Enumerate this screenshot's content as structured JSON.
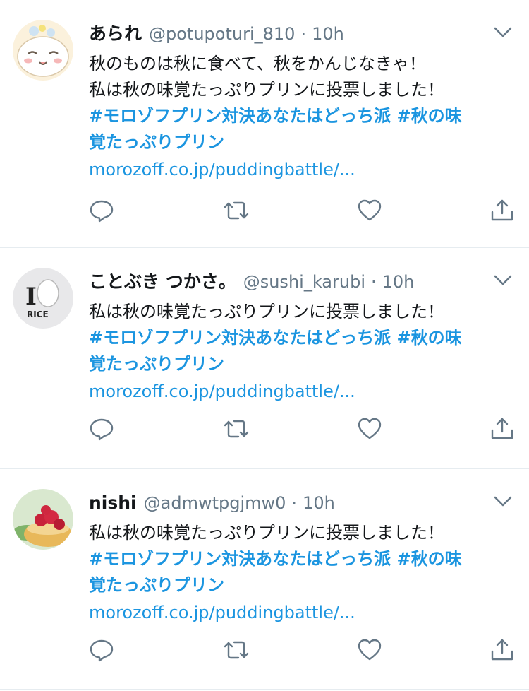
{
  "tweets": [
    {
      "name": "あられ",
      "handle": "@potupoturi_810",
      "separator": "·",
      "time": "10h",
      "text_lines": [
        "秋のものは秋に食べて、秋をかんじなきゃ！",
        "私は秋の味覚たっぷりプリンに投票しました！"
      ],
      "hashtag_line1": "#モロゾフプリン対決あなたはどっち派 #秋の味",
      "hashtag_line2": "覚たっぷりプリン",
      "link": "morozoff.co.jp/puddingbattle/..."
    },
    {
      "name": "ことぶき つかさ。",
      "handle": "@sushi_karubi",
      "separator": "·",
      "time": "10h",
      "text_lines": [
        "私は秋の味覚たっぷりプリンに投票しました！"
      ],
      "hashtag_line1": "#モロゾフプリン対決あなたはどっち派 #秋の味",
      "hashtag_line2": "覚たっぷりプリン",
      "link": "morozoff.co.jp/puddingbattle/...",
      "avatar_text": "RICE"
    },
    {
      "name": "nishi",
      "handle": "@admwtpgjmw0",
      "separator": "·",
      "time": "10h",
      "text_lines": [
        "私は秋の味覚たっぷりプリンに投票しました！"
      ],
      "hashtag_line1": "#モロゾフプリン対決あなたはどっち派 #秋の味",
      "hashtag_line2": "覚たっぷりプリン",
      "link": "morozoff.co.jp/puddingbattle/..."
    }
  ],
  "colors": {
    "accent": "#1b95e0",
    "muted": "#657786",
    "text": "#14171a",
    "divider": "#e6ecf0"
  },
  "icons": [
    "reply-icon",
    "retweet-icon",
    "like-icon",
    "share-icon",
    "chevron-down-icon"
  ]
}
